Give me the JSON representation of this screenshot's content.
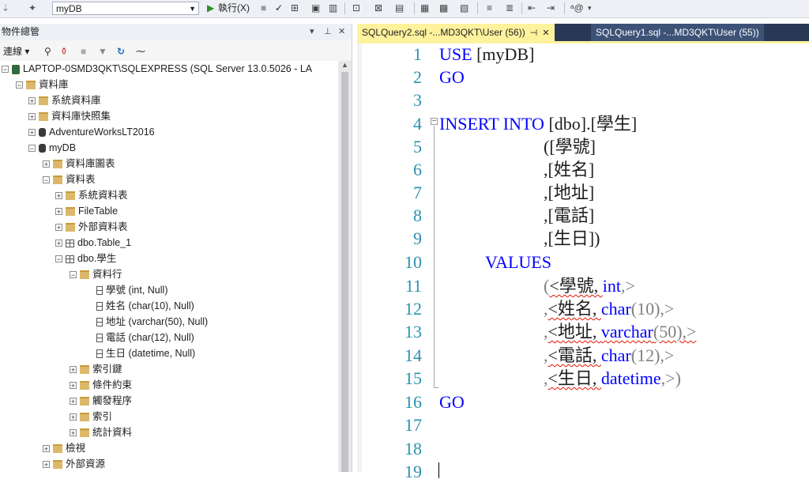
{
  "toolbar": {
    "database": "myDB",
    "execute_label": "執行(X)"
  },
  "object_explorer": {
    "title": "物件總管",
    "pin_label": "▾ ⊥ ×",
    "connect_label": "連線 ▾"
  },
  "tree": {
    "server": "LAPTOP-0SMD3QKT\\SQLEXPRESS (SQL Server 13.0.5026 - LA",
    "databases": "資料庫",
    "system_databases": "系統資料庫",
    "db_snapshots": "資料庫快照集",
    "adventureworks": "AdventureWorksLT2016",
    "mydb": "myDB",
    "db_diagrams": "資料庫圖表",
    "tables": "資料表",
    "system_tables": "系統資料表",
    "filetable": "FileTable",
    "external_tables": "外部資料表",
    "table1": "dbo.Table_1",
    "student_table": "dbo.學生",
    "columns": "資料行",
    "col1": "學號 (int, Null)",
    "col2": "姓名 (char(10), Null)",
    "col3": "地址 (varchar(50), Null)",
    "col4": "電話 (char(12), Null)",
    "col5": "生日 (datetime, Null)",
    "keys": "索引鍵",
    "constraints": "條件約束",
    "triggers": "觸發程序",
    "indexes": "索引",
    "statistics": "統計資料",
    "views": "檢視",
    "external_resources": "外部資源"
  },
  "editor": {
    "tab_active": "SQLQuery2.sql -...MD3QKT\\User (56))",
    "tab_inactive": "SQLQuery1.sql -...MD3QKT\\User (55))",
    "line_numbers": [
      "1",
      "2",
      "3",
      "4",
      "5",
      "6",
      "7",
      "8",
      "9",
      "10",
      "11",
      "12",
      "13",
      "14",
      "15",
      "16",
      "17",
      "18",
      "19"
    ],
    "code": {
      "l1_kw": "USE",
      "l1_rest": " [myDB]",
      "l2_kw": "GO",
      "l4_kw": "INSERT INTO",
      "l4_rest": " [dbo].[學生]",
      "l5": "([學號]",
      "l6": ",[姓名]",
      "l7": ",[地址]",
      "l8": ",[電話]",
      "l9": ",[生日])",
      "l10_kw": "VALUES",
      "l11_a": "(",
      "l11_b": "<學號, ",
      "l11_ty": "int",
      "l11_c": ",>",
      "l12_a": ",",
      "l12_b": "<姓名, ",
      "l12_ty": "char",
      "l12_c": "(10),>",
      "l13_a": ",",
      "l13_b": "<地址, ",
      "l13_ty": "varchar",
      "l13_c": "(50),>",
      "l14_a": ",",
      "l14_b": "<電話, ",
      "l14_ty": "char",
      "l14_c": "(12),>",
      "l15_a": ",",
      "l15_b": "<生日, ",
      "l15_ty": "datetime",
      "l15_c": ",>",
      "l15_d": ")",
      "l16_kw": "GO"
    }
  },
  "colors": {
    "keyword": "#0000ff",
    "line_number": "#2b91af",
    "active_tab": "#fff29d",
    "tab_bar": "#293955"
  }
}
